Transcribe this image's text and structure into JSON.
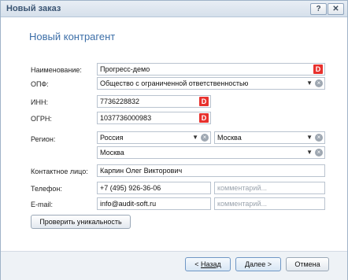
{
  "window": {
    "title": "Новый заказ",
    "help_label": "?",
    "close_label": "✕"
  },
  "page_title": "Новый контрагент",
  "form": {
    "name_label": "Наименование:",
    "name_value": "Прогресс-демо",
    "opf_label": "ОПФ:",
    "opf_value": "Общество с ограниченной ответственностью",
    "inn_label": "ИНН:",
    "inn_value": "7736228832",
    "ogrn_label": "ОГРН:",
    "ogrn_value": "1037736000983",
    "region_label": "Регион:",
    "country_value": "Россия",
    "region_value": "Москва",
    "city_value": "Москва",
    "contact_label": "Контактное лицо:",
    "contact_value": "Карпин Олег Викторович",
    "phone_label": "Телефон:",
    "phone_value": "+7 (495) 926-36-06",
    "phone_comment_placeholder": "комментарий...",
    "email_label": "E-mail:",
    "email_value": "info@audit-soft.ru",
    "email_comment_placeholder": "комментарий...",
    "check_button": "Проверить уникальность",
    "badge_letter": "D"
  },
  "footer": {
    "back_prefix": "< ",
    "back_label": "Назад",
    "next_label": "Далее >",
    "cancel_label": "Отмена"
  },
  "icons": {
    "dropdown": "chevron-down-icon",
    "clear": "clear-icon",
    "badge": "d-badge-icon"
  },
  "colors": {
    "title": "#3d6fa8",
    "badge": "#e8312d",
    "titlebar": "#d6e0eb"
  }
}
